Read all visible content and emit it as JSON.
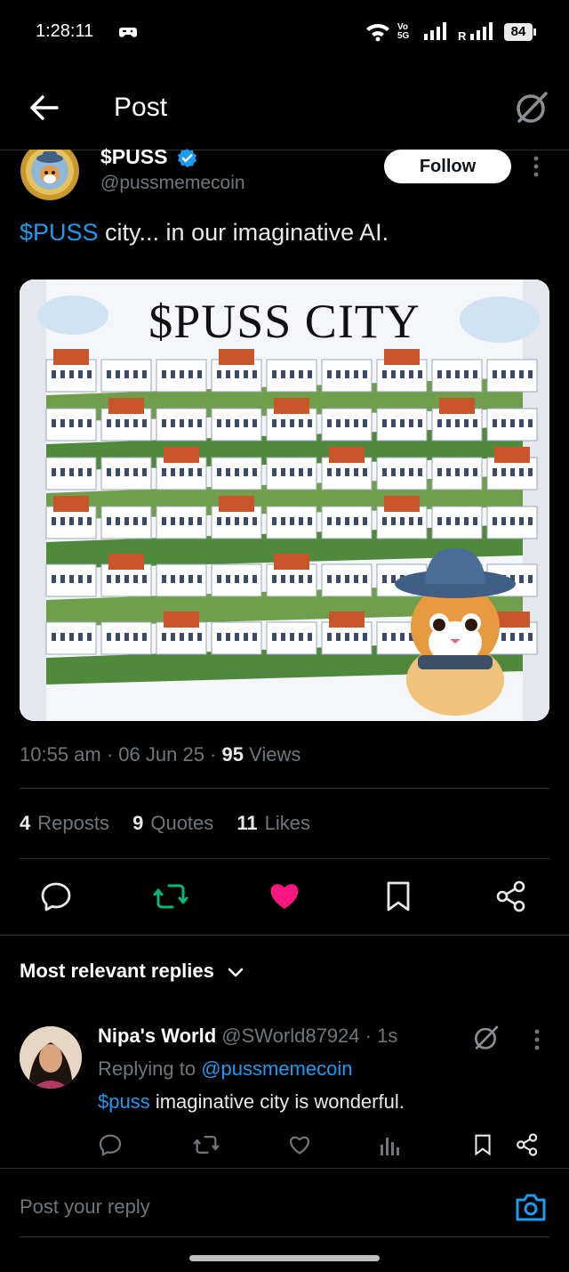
{
  "status_bar": {
    "time": "1:28:11",
    "network_label": "Vo 5G",
    "sim2_label": "R",
    "battery": "84"
  },
  "header": {
    "title": "Post"
  },
  "post": {
    "author": {
      "display_name": "$PUSS",
      "handle": "@pussmemecoin",
      "verified": true
    },
    "follow_label": "Follow",
    "text_mention": "$PUSS",
    "text_rest": " city... in our imaginative AI.",
    "media": {
      "title": "$PUSS CITY"
    },
    "meta": {
      "time": "10:55 am",
      "date": "06 Jun 25",
      "views_count": "95",
      "views_label": "Views"
    },
    "stats": {
      "reposts_count": "4",
      "reposts_label": "Reposts",
      "quotes_count": "9",
      "quotes_label": "Quotes",
      "likes_count": "11",
      "likes_label": "Likes"
    },
    "actions": {
      "reply": "reply-icon",
      "repost": "repost-icon",
      "like": "heart-icon",
      "bookmark": "bookmark-icon",
      "share": "share-icon"
    }
  },
  "replies": {
    "sort_label": "Most relevant replies",
    "items": [
      {
        "display_name": "Nipa's World",
        "handle_time": "@SWorld87924 · 1s",
        "replying_to_prefix": "Replying to ",
        "replying_to_handle": "@pussmemecoin",
        "text_mention": "$puss",
        "text_rest": " imaginative city is wonderful."
      }
    ]
  },
  "composer": {
    "placeholder": "Post your reply"
  },
  "colors": {
    "accent": "#1d9bf0",
    "repost_active": "#00ba7c",
    "like_active": "#f91880",
    "muted": "#71767b"
  }
}
